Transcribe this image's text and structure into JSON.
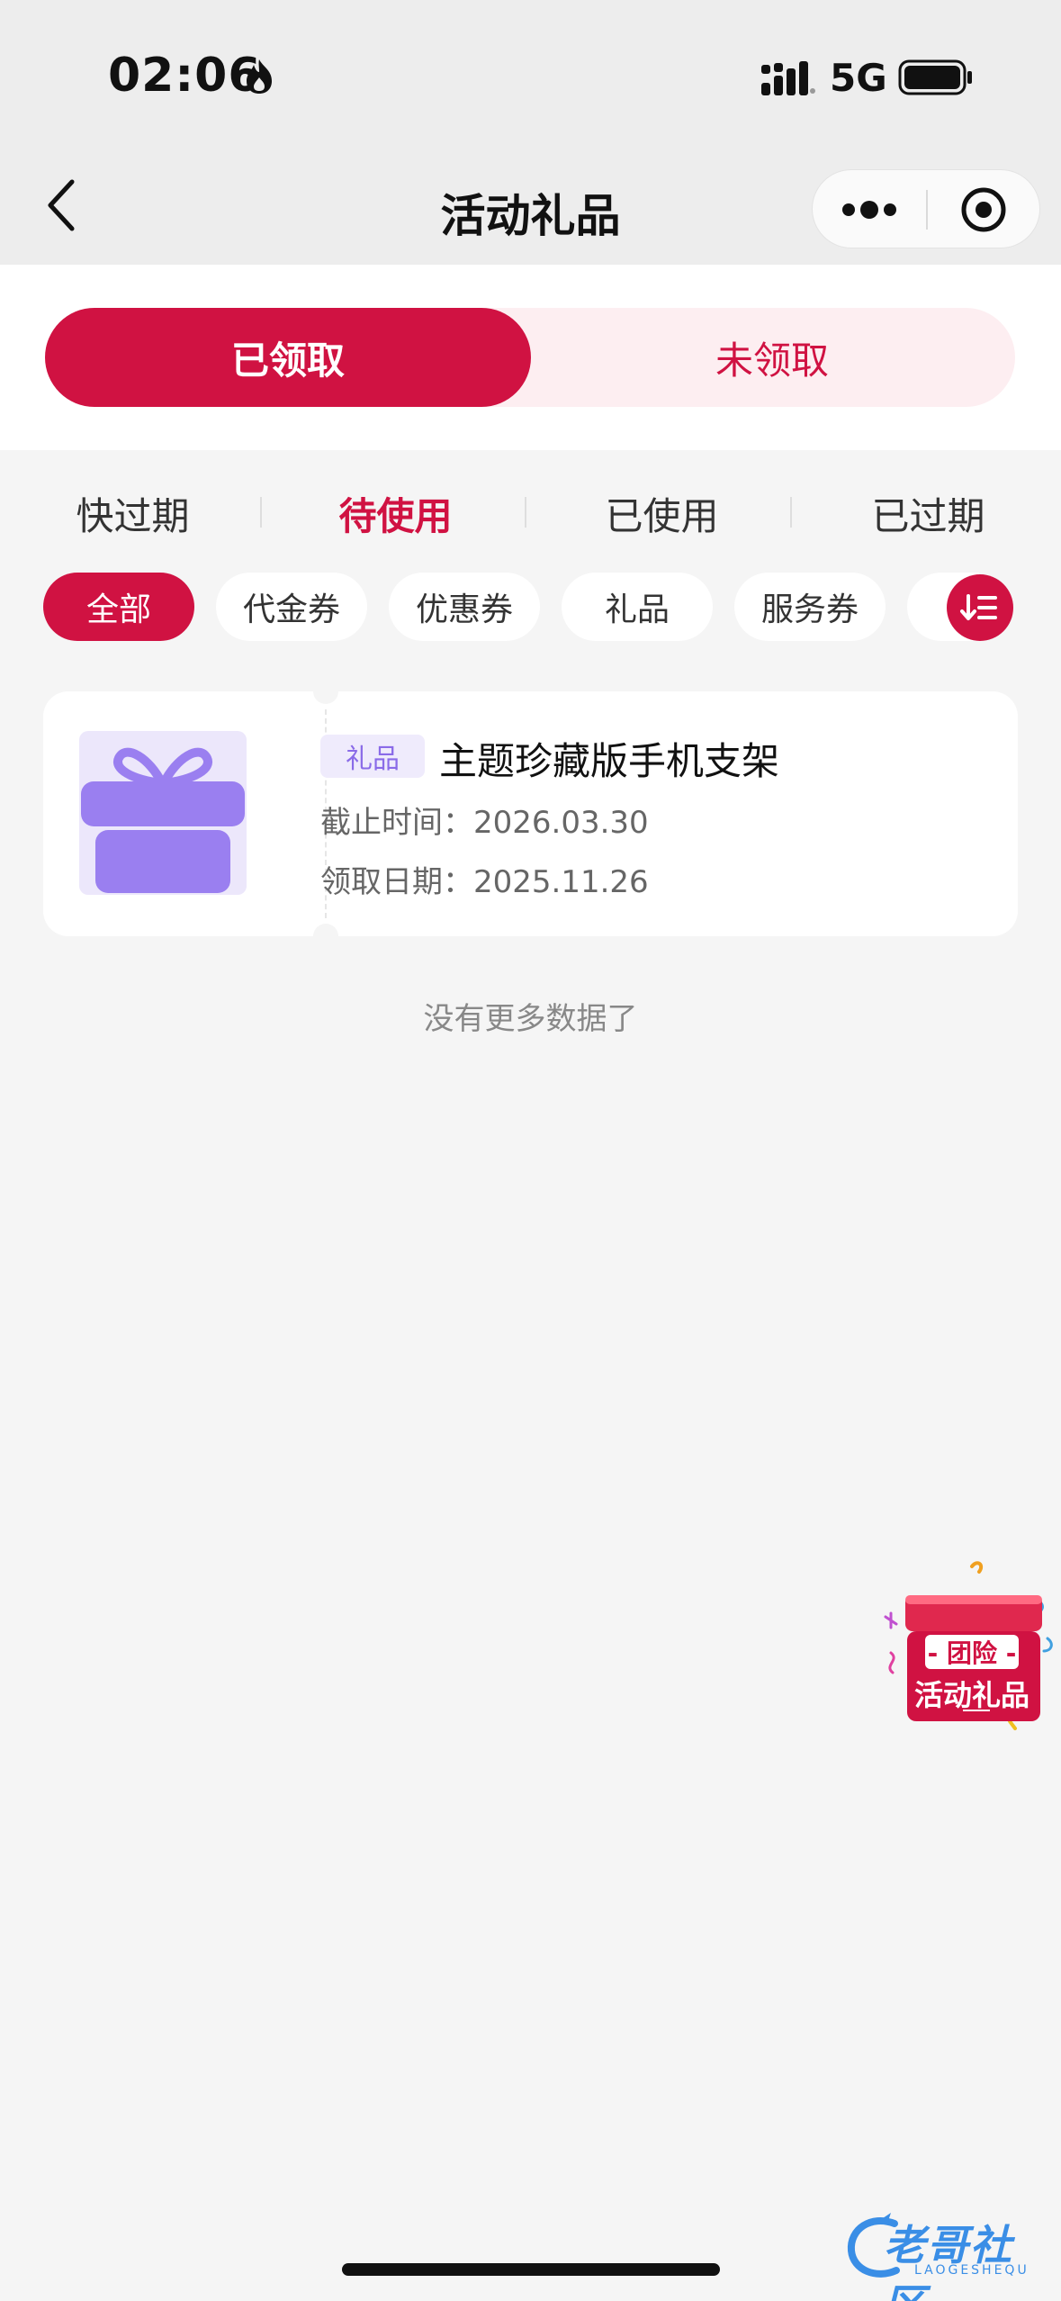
{
  "status_bar": {
    "time": "02:06",
    "network": "5G",
    "icons": [
      "flame-icon",
      "signal-icon",
      "battery-icon"
    ]
  },
  "nav": {
    "title": "活动礼品",
    "icons": [
      "back-icon",
      "more-dots-icon",
      "target-icon"
    ]
  },
  "top_tabs": {
    "received": "已领取",
    "unreceived": "未领取",
    "active": "已领取"
  },
  "status_tabs": {
    "items": [
      "快过期",
      "待使用",
      "已使用",
      "已过期"
    ],
    "active": "待使用"
  },
  "filter_chips": {
    "items": [
      "全部",
      "代金券",
      "优惠券",
      "礼品",
      "服务券"
    ],
    "active": "全部",
    "sort_icon": "sort-icon"
  },
  "gifts": [
    {
      "tag": "礼品",
      "name": "主题珍藏版手机支架",
      "deadline_label": "截止时间：",
      "deadline": "2026.03.30",
      "received_label": "领取日期：",
      "received": "2025.11.26",
      "icon": "gift-icon"
    }
  ],
  "no_more": "没有更多数据了",
  "float_badge": {
    "line1": "- 团险 -",
    "line2": "活动礼品"
  },
  "watermark": {
    "text": "老哥社区",
    "sub": "LAOGESHEQU"
  },
  "colors": {
    "accent": "#d01242",
    "accent_light": "#fdeef1",
    "gift_purple": "#9a7ff0",
    "background": "#f5f5f5"
  }
}
